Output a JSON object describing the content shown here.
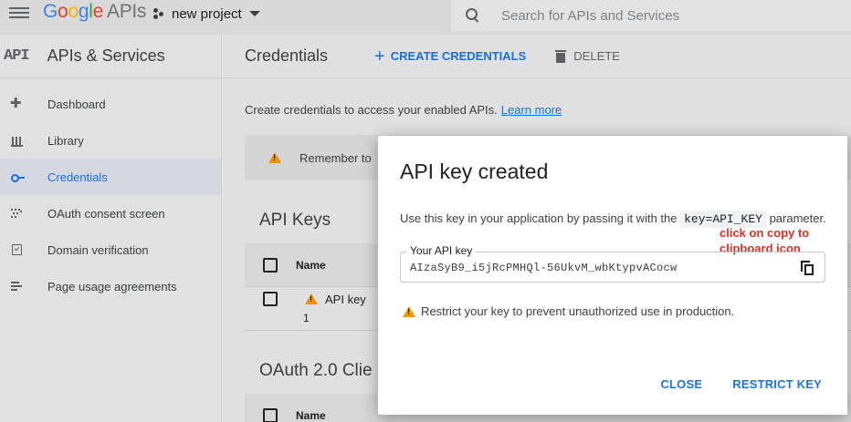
{
  "header": {
    "logo": {
      "G": "G",
      "o1": "o",
      "o2": "o",
      "g": "g",
      "l": "l",
      "e": "e",
      "apis": "APIs"
    },
    "project": "new project",
    "search_placeholder": "Search for APIs and Services"
  },
  "sidebar": {
    "badge": "API",
    "title": "APIs & Services",
    "items": [
      {
        "label": "Dashboard",
        "icon": "dashboard-icon"
      },
      {
        "label": "Library",
        "icon": "library-icon"
      },
      {
        "label": "Credentials",
        "icon": "key-icon",
        "active": true
      },
      {
        "label": "OAuth consent screen",
        "icon": "oauth-consent-icon"
      },
      {
        "label": "Domain verification",
        "icon": "domain-verification-icon"
      },
      {
        "label": "Page usage agreements",
        "icon": "page-usage-icon"
      }
    ]
  },
  "main": {
    "title": "Credentials",
    "create_label": "CREATE CREDENTIALS",
    "delete_label": "DELETE",
    "intro_text": "Create credentials to access your enabled APIs.",
    "learn_more": "Learn more",
    "notice_text": "Remember to",
    "api_keys_title": "API Keys",
    "name_header": "Name",
    "api_key_row_name": "API key",
    "api_key_row_num": "1",
    "oauth_title": "OAuth 2.0 Clie",
    "oauth_name_header": "Name"
  },
  "dialog": {
    "title": "API key created",
    "body_before": "Use this key in your application by passing it with the",
    "body_code": "key=API_KEY",
    "body_after": "parameter.",
    "field_label": "Your API key",
    "key_value": "AIzaSyB9_i5jRcPMHQl-56UkvM_wbKtypvACocw",
    "annotation": "click on copy to clipboard icon",
    "restrict_note": "Restrict your key to prevent unauthorized use in production.",
    "close_label": "CLOSE",
    "restrict_label": "RESTRICT KEY"
  },
  "colors": {
    "accent": "#1a73e8",
    "warning": "#f29900",
    "annotation": "#d93025"
  }
}
